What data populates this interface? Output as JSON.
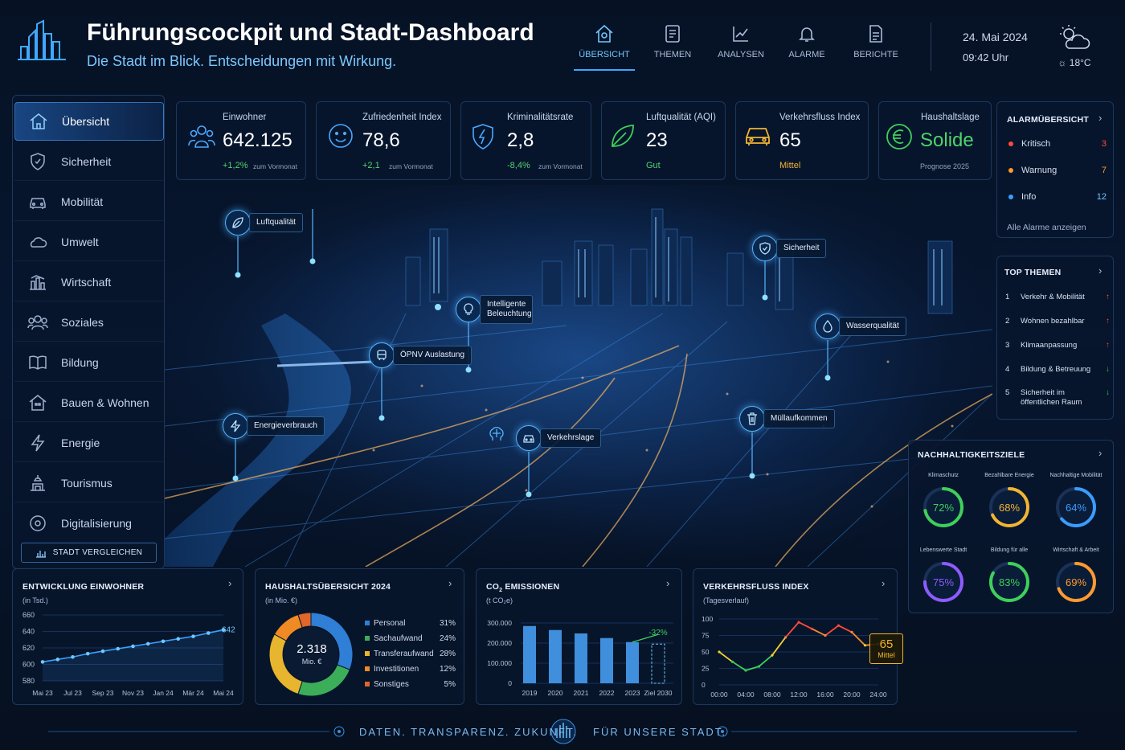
{
  "header": {
    "title": "Führungscockpit und Stadt-Dashboard",
    "subtitle": "Die Stadt im Blick. Entscheidungen mit Wirkung.",
    "nav": [
      {
        "label": "ÜBERSICHT",
        "icon": "home-icon",
        "active": true
      },
      {
        "label": "THEMEN",
        "icon": "document-list-icon"
      },
      {
        "label": "ANALYSEN",
        "icon": "line-chart-icon"
      },
      {
        "label": "ALARME",
        "icon": "bell-icon"
      },
      {
        "label": "BERICHTE",
        "icon": "report-icon"
      }
    ],
    "date": "24. Mai 2024",
    "time": "09:42 Uhr",
    "temperature": "18°C"
  },
  "sidebar": {
    "items": [
      {
        "label": "Übersicht",
        "icon": "home-icon",
        "active": true
      },
      {
        "label": "Sicherheit",
        "icon": "shield-icon"
      },
      {
        "label": "Mobilität",
        "icon": "car-icon"
      },
      {
        "label": "Umwelt",
        "icon": "cloud-icon"
      },
      {
        "label": "Wirtschaft",
        "icon": "buildings-chart-icon"
      },
      {
        "label": "Soziales",
        "icon": "people-icon"
      },
      {
        "label": "Bildung",
        "icon": "book-icon"
      },
      {
        "label": "Bauen & Wohnen",
        "icon": "house-icon"
      },
      {
        "label": "Energie",
        "icon": "lightning-icon"
      },
      {
        "label": "Tourismus",
        "icon": "landmark-icon"
      },
      {
        "label": "Digitalisierung",
        "icon": "digital-icon"
      }
    ],
    "compare_button": "STADT VERGLEICHEN"
  },
  "kpis": [
    {
      "label": "Einwohner",
      "value": "642.125",
      "change": "+1,2%",
      "sub": "zum Vormonat",
      "icon": "people-icon"
    },
    {
      "label": "Zufriedenheit Index",
      "value": "78,6",
      "change": "+2,1",
      "sub": "zum Vormonat",
      "icon": "smiley-icon"
    },
    {
      "label": "Kriminalitätsrate",
      "value": "2,8",
      "change": "-8,4%",
      "sub": "zum Vormonat",
      "icon": "shield-icon"
    },
    {
      "label": "Luftqualität (AQI)",
      "value": "23",
      "change": "Gut",
      "sub": "",
      "icon": "leaf-icon"
    },
    {
      "label": "Verkehrsfluss Index",
      "value": "65",
      "change": "Mittel",
      "sub": "",
      "icon": "car-icon"
    },
    {
      "label": "Haushaltslage",
      "value": "Solide",
      "change": "Prognose 2025",
      "sub": "",
      "icon": "euro-icon"
    }
  ],
  "alarms": {
    "title": "ALARMÜBERSICHT",
    "rows": [
      {
        "label": "Kritisch",
        "count": "3",
        "color": "#ff4a3d"
      },
      {
        "label": "Warnung",
        "count": "7",
        "color": "#ff9a2e"
      },
      {
        "label": "Info",
        "count": "12",
        "color": "#3aa0ff"
      }
    ],
    "link": "Alle Alarme anzeigen"
  },
  "topics": {
    "title": "TOP THEMEN",
    "items": [
      {
        "n": "1",
        "label": "Verkehr & Mobilität",
        "trend": "up"
      },
      {
        "n": "2",
        "label": "Wohnen bezahlbar",
        "trend": "up"
      },
      {
        "n": "3",
        "label": "Klimaanpassung",
        "trend": "up"
      },
      {
        "n": "4",
        "label": "Bildung & Betreuung",
        "trend": "down"
      },
      {
        "n": "5",
        "label": "Sicherheit im öffentlichen Raum",
        "trend": "down"
      }
    ]
  },
  "goals": {
    "title": "NACHHALTIGKEITSZIELE",
    "items": [
      {
        "label": "Klimaschutz",
        "value": "72%",
        "pct": 72,
        "color": "#3fcf5a"
      },
      {
        "label": "Bezahlbare Energie",
        "value": "68%",
        "pct": 68,
        "color": "#f2b431"
      },
      {
        "label": "Nachhaltige Mobilität",
        "value": "64%",
        "pct": 64,
        "color": "#3a9cff"
      },
      {
        "label": "Lebenswerte Stadt",
        "value": "75%",
        "pct": 75,
        "color": "#8d5bff"
      },
      {
        "label": "Bildung für alle",
        "value": "83%",
        "pct": 83,
        "color": "#3fcf5a"
      },
      {
        "label": "Wirtschaft & Arbeit",
        "value": "69%",
        "pct": 69,
        "color": "#ff9a2e"
      }
    ]
  },
  "map": {
    "pois": [
      {
        "label": "Luftqualität",
        "icon": "leaf-icon"
      },
      {
        "label": "Intelligente Beleuchtung",
        "icon": "lightbulb-icon"
      },
      {
        "label": "ÖPNV Auslastung",
        "icon": "tram-icon"
      },
      {
        "label": "Energieverbrauch",
        "icon": "lightning-icon"
      },
      {
        "label": "Verkehrslage",
        "icon": "car-icon"
      },
      {
        "label": "Sicherheit",
        "icon": "shield-icon"
      },
      {
        "label": "Wasserqualität",
        "icon": "water-drop-icon"
      },
      {
        "label": "Müllaufkommen",
        "icon": "trash-icon"
      }
    ]
  },
  "chart_data": [
    {
      "type": "line",
      "title": "ENTWICKLUNG EINWOHNER",
      "ylabel": "(in Tsd.)",
      "x": [
        "Mai 23",
        "Jun 23",
        "Jul 23",
        "Aug 23",
        "Sep 23",
        "Okt 23",
        "Nov 23",
        "Dez 23",
        "Jan 24",
        "Feb 24",
        "Mär 24",
        "Apr 24",
        "Mai 24"
      ],
      "x_ticks": [
        "Mai 23",
        "Jul 23",
        "Sep 23",
        "Nov 23",
        "Jan 24",
        "Mär 24",
        "Mai 24"
      ],
      "values": [
        603,
        606,
        609,
        613,
        616,
        619,
        622,
        625,
        628,
        631,
        634,
        638,
        642
      ],
      "end_label": "642",
      "ylim": [
        580,
        660
      ],
      "yticks": [
        "660",
        "640",
        "620",
        "600",
        "580"
      ]
    },
    {
      "type": "pie",
      "title": "HAUSHALTSÜBERSICHT 2024",
      "ylabel": "(in Mio. €)",
      "center_value": "2.318",
      "center_unit": "Mio. €",
      "slices": [
        {
          "label": "Personal",
          "value": 31,
          "display": "31%",
          "color": "#2f7fd6"
        },
        {
          "label": "Sachaufwand",
          "value": 24,
          "display": "24%",
          "color": "#3cae5a"
        },
        {
          "label": "Transferaufwand",
          "value": 28,
          "display": "28%",
          "color": "#e8b52e"
        },
        {
          "label": "Investitionen",
          "value": 12,
          "display": "12%",
          "color": "#f08a24"
        },
        {
          "label": "Sonstiges",
          "value": 5,
          "display": "5%",
          "color": "#e0662a"
        }
      ]
    },
    {
      "type": "bar",
      "title_main": "CO",
      "title_sub": "2",
      "title_rest": " EMISSIONEN",
      "ylabel": "(t CO₂e)",
      "categories": [
        "2019",
        "2020",
        "2021",
        "2022",
        "2023",
        "Ziel 2030"
      ],
      "values": [
        285000,
        265000,
        248000,
        225000,
        205000,
        195000
      ],
      "target_label": "-32%",
      "ylim": [
        0,
        300000
      ],
      "yticks": [
        "300.000",
        "200.000",
        "100.000",
        "0"
      ]
    },
    {
      "type": "line",
      "title": "VERKEHRSFLUSS INDEX",
      "ylabel": "(Tagesverlauf)",
      "x": [
        "00:00",
        "02:00",
        "04:00",
        "06:00",
        "08:00",
        "10:00",
        "12:00",
        "14:00",
        "16:00",
        "18:00",
        "20:00",
        "22:00",
        "24:00"
      ],
      "x_ticks": [
        "00:00",
        "04:00",
        "08:00",
        "12:00",
        "16:00",
        "20:00",
        "24:00"
      ],
      "values": [
        50,
        35,
        22,
        28,
        45,
        72,
        95,
        85,
        75,
        90,
        80,
        60,
        62
      ],
      "ylim": [
        0,
        100
      ],
      "yticks": [
        "100",
        "75",
        "50",
        "25",
        "0"
      ],
      "badge_value": "65",
      "badge_label": "Mittel"
    }
  ],
  "footer": {
    "left": "DATEN. TRANSPARENZ. ZUKUNFT.",
    "right": "FÜR UNSERE STADT."
  }
}
